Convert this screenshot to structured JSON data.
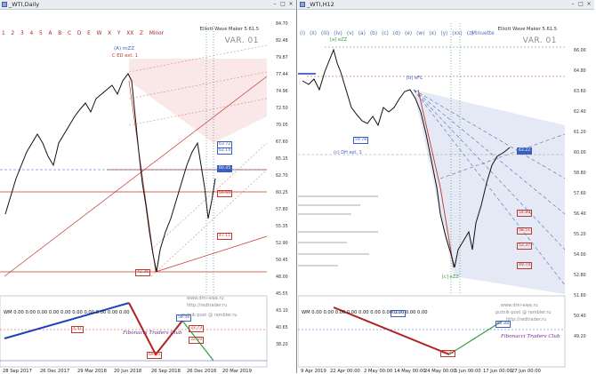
{
  "left": {
    "title": "_WTI,Daily",
    "symbol": "_WTI,Daily",
    "indicator": "Elliott Wave Maker 5.61.5",
    "variant": "VAR. 01",
    "wave_labels": [
      "1",
      "2",
      "3",
      "4",
      "5",
      "A",
      "B",
      "C",
      "D",
      "E",
      "W",
      "X",
      "Y",
      "XX",
      "Z",
      "Minor"
    ],
    "wm_readout": "WM 0.00 0.00 0.00 0.00 0.00 0.00 0.00 0.00 0.00 0.00",
    "fib_club": "Fibonacci Traders Club",
    "site_1": "www.dmi-ewa.ru",
    "site_2": "http://redtrader.ru",
    "site_3": "putnik-post @ rambler.ru",
    "corr_label": "(A) mZZ",
    "corr_sub": "C ED ext. 1",
    "y_ticks": [
      "84.70",
      "82.48",
      "79.87",
      "77.44",
      "74.96",
      "72.50",
      "70.05",
      "67.60",
      "65.15",
      "62.70",
      "60.25",
      "57.80",
      "55.35",
      "52.90",
      "50.45",
      "48.00",
      "45.55",
      "43.10",
      "40.65",
      "38.20"
    ],
    "x_ticks": [
      "28 Sep 2017",
      "26 Dec 2017",
      "29 Mar 2018",
      "20 Jun 2018",
      "26 Sep 2018",
      "26 Dec 2018",
      "20 Mar 2019"
    ],
    "price_tags": [
      {
        "text": "63.72",
        "color": "#3a5fc0"
      },
      {
        "text": "62.14",
        "color": "#3a5fc0"
      },
      {
        "text": "60.45",
        "color": "#3a5fc0"
      },
      {
        "text": "56.60",
        "color": "#c0392b"
      },
      {
        "text": "47.11",
        "color": "#c0392b"
      },
      {
        "text": "42.36",
        "color": "#c0392b"
      }
    ],
    "osc_tags": [
      "4.41",
      "56.56",
      "33.73",
      "32.59",
      "69.15"
    ]
  },
  "right": {
    "title": "_WTI,H12",
    "symbol": "_WTI,H12",
    "indicator": "Elliott Wave Maker 5.61.5",
    "variant": "VAR. 01",
    "wave_labels": [
      "(i)",
      "(ii)",
      "(iii)",
      "(iv)",
      "(v)",
      "(a)",
      "(b)",
      "(c)",
      "(d)",
      "(e)",
      "(w)",
      "(x)",
      "(y)",
      "(xx)",
      "(z)"
    ],
    "degree": "Minuette",
    "wm_readout": "WM 0.00 0.00 0.00 0.00 0.00 0.00 0.00 0.00 0.00 0.00",
    "fib_club": "Fibonacci Traders Club",
    "site_1": "www.dmi-ewa.ru",
    "site_2": "putnik-post @ rambler.ru",
    "site_3": "http://redtrader.ru",
    "top_label": "[a] eZZ",
    "mid_label": "[b] eFL",
    "end_label": "[c] eZZ",
    "ext_label": "(c) DH ext. 1",
    "y_ticks": [
      "66.00",
      "64.80",
      "63.60",
      "62.40",
      "61.20",
      "60.00",
      "58.80",
      "57.60",
      "56.40",
      "55.20",
      "54.00",
      "52.80",
      "51.60",
      "50.40",
      "49.20"
    ],
    "x_ticks": [
      "9 Apr 2019",
      "22 Apr 00:00",
      "2 May 00:00",
      "14 May 00:00",
      "24 May 00:00",
      "5 Jun 00:00",
      "17 Jun 00:00",
      "27 Jun 00:00"
    ],
    "price_tags": [
      {
        "text": "63.22",
        "color": "#3a5fc0"
      },
      {
        "text": "59.78",
        "color": "#3a5fc0"
      },
      {
        "text": "54.89",
        "color": "#c0392b"
      },
      {
        "text": "53.51",
        "color": "#c0392b"
      },
      {
        "text": "52.37",
        "color": "#c0392b"
      },
      {
        "text": "49.74",
        "color": "#c0392b"
      }
    ],
    "osc_tags": [
      "63.70",
      "40.89",
      "62.88"
    ]
  }
}
